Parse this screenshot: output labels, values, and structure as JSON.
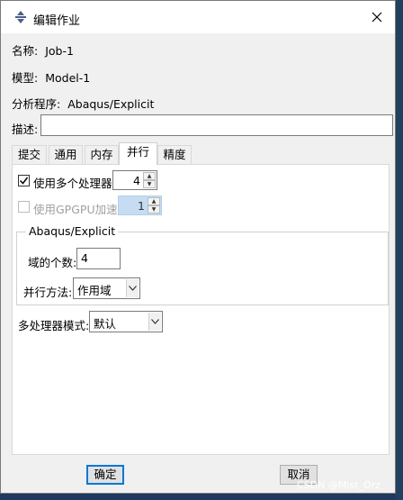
{
  "window": {
    "title": "编辑作业",
    "close_glyph": "✕"
  },
  "job": {
    "name_label": "名称:",
    "name_value": "Job-1",
    "model_label": "模型:",
    "model_value": "Model-1",
    "program_label": "分析程序:",
    "program_value": "Abaqus/Explicit",
    "description_label": "描述:",
    "description_value": ""
  },
  "tabs": [
    {
      "label": "提交",
      "active": false
    },
    {
      "label": "通用",
      "active": false
    },
    {
      "label": "内存",
      "active": false
    },
    {
      "label": "并行",
      "active": true
    },
    {
      "label": "精度",
      "active": false
    }
  ],
  "parallel": {
    "multi_cpu_label": "使用多个处理器",
    "multi_cpu_checked": true,
    "cpu_count": "4",
    "gpgpu_label": "使用GPGPU加速",
    "gpgpu_checked": false,
    "gpgpu_count": "1",
    "group_title": "Abaqus/Explicit",
    "domains_label": "域的个数:",
    "domains_value": "4",
    "method_label": "并行方法:",
    "method_value": "作用域",
    "mp_mode_label": "多处理器模式:",
    "mp_mode_value": "默认"
  },
  "footer": {
    "ok_label": "确定",
    "cancel_label": "取消",
    "watermark": "CSDN @Mist_Orz"
  },
  "colors": {
    "accent": "#0078d7",
    "dialog_bg": "#f0f0f0",
    "panel_bg": "#ffffff",
    "desktop_bg": "#1e3a5f",
    "disabled_spin_bg": "#c5dcf3"
  },
  "icons": {
    "app": "abaqus-app-icon",
    "close": "close-icon",
    "check": "checkmark-icon",
    "spin_up": "spin-up-icon",
    "spin_down": "spin-down-icon",
    "dropdown": "chevron-down-icon"
  }
}
